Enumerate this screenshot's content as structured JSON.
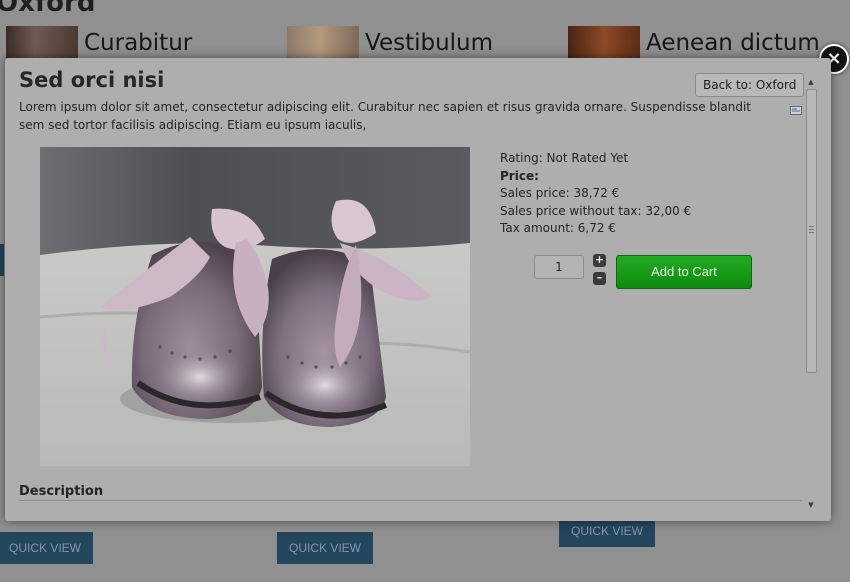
{
  "background": {
    "category_title": "Oxford",
    "products": [
      {
        "name": "Curabitur"
      },
      {
        "name": "Vestibulum"
      },
      {
        "name": "Aenean dictum"
      }
    ],
    "quick_view_label": "QUICK VIEW"
  },
  "modal": {
    "close_symbol": "×",
    "title": "Sed orci nisi",
    "back_button": "Back to: Oxford",
    "short_description": "Lorem ipsum dolor sit amet, consectetur adipiscing elit. Curabitur nec sapien et risus gravida ornare. Suspendisse blandit sem sed tortor facilisis adipiscing. Etiam eu ipsum iaculis,",
    "rating": "Rating: Not Rated Yet",
    "price_label": "Price:",
    "sales_price": "Sales price: 38,72 €",
    "sales_price_without_tax": "Sales price without tax: 32,00 €",
    "tax_amount": "Tax amount: 6,72 €",
    "quantity": "1",
    "qty_plus": "+",
    "qty_minus": "–",
    "add_to_cart": "Add to Cart",
    "description_heading": "Description",
    "icons": {
      "email": "email-icon",
      "close": "close-icon"
    }
  }
}
